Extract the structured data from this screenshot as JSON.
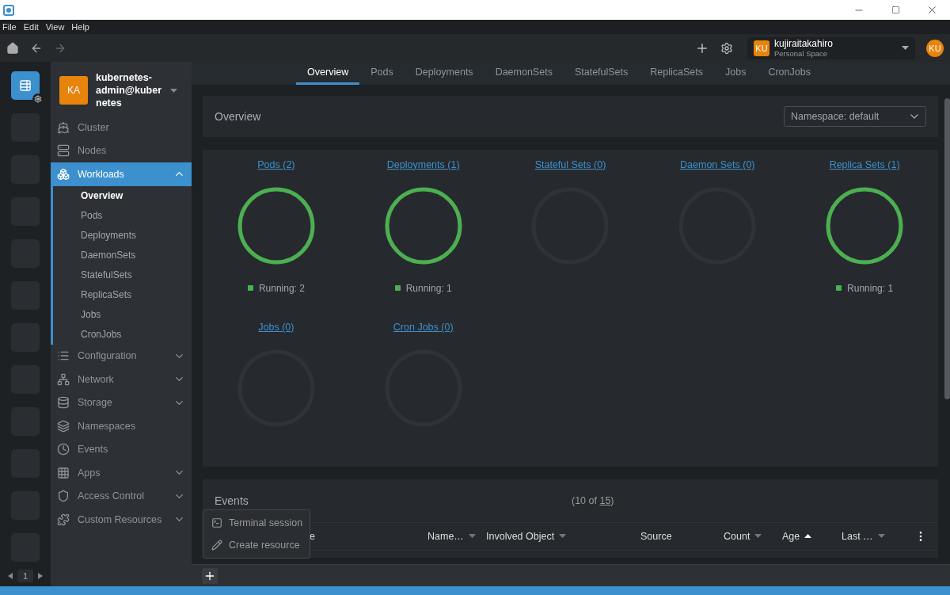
{
  "menu": [
    "File",
    "Edit",
    "View",
    "Help"
  ],
  "account": {
    "avatar": "KU",
    "name": "kujiraitakahiro",
    "subtitle": "Personal Space",
    "badge": "KU"
  },
  "hotbar": {
    "slots": [
      {
        "selected": true
      },
      {
        "selected": false
      },
      {
        "selected": false
      },
      {
        "selected": false
      },
      {
        "selected": false
      },
      {
        "selected": false
      },
      {
        "selected": false
      },
      {
        "selected": false
      },
      {
        "selected": false
      },
      {
        "selected": false
      },
      {
        "selected": false
      },
      {
        "selected": false
      }
    ],
    "page": "1"
  },
  "cluster": {
    "avatar": "KA",
    "name": "kubernetes-admin@kubernetes"
  },
  "sidebar": {
    "items": [
      {
        "label": "Cluster",
        "selected": false
      },
      {
        "label": "Nodes",
        "selected": false
      },
      {
        "label": "Workloads",
        "selected": true,
        "expanded": true,
        "children": [
          {
            "label": "Overview",
            "selected": true
          },
          {
            "label": "Pods",
            "selected": false
          },
          {
            "label": "Deployments",
            "selected": false
          },
          {
            "label": "DaemonSets",
            "selected": false
          },
          {
            "label": "StatefulSets",
            "selected": false
          },
          {
            "label": "ReplicaSets",
            "selected": false
          },
          {
            "label": "Jobs",
            "selected": false
          },
          {
            "label": "CronJobs",
            "selected": false
          }
        ]
      },
      {
        "label": "Configuration",
        "selected": false,
        "expanded": false
      },
      {
        "label": "Network",
        "selected": false,
        "expanded": false
      },
      {
        "label": "Storage",
        "selected": false,
        "expanded": false
      },
      {
        "label": "Namespaces",
        "selected": false
      },
      {
        "label": "Events",
        "selected": false
      },
      {
        "label": "Apps",
        "selected": false,
        "expanded": false
      },
      {
        "label": "Access Control",
        "selected": false,
        "expanded": false
      },
      {
        "label": "Custom Resources",
        "selected": false,
        "expanded": false
      }
    ]
  },
  "tabs": [
    {
      "label": "Overview",
      "selected": true
    },
    {
      "label": "Pods",
      "selected": false
    },
    {
      "label": "Deployments",
      "selected": false
    },
    {
      "label": "DaemonSets",
      "selected": false
    },
    {
      "label": "StatefulSets",
      "selected": false
    },
    {
      "label": "ReplicaSets",
      "selected": false
    },
    {
      "label": "Jobs",
      "selected": false
    },
    {
      "label": "CronJobs",
      "selected": false
    }
  ],
  "overview": {
    "title": "Overview",
    "namespace": "Namespace: default",
    "workloads": [
      {
        "title": "Pods (2)",
        "level": 1,
        "status": "Running: 2"
      },
      {
        "title": "Deployments (1)",
        "level": 1,
        "status": "Running: 1"
      },
      {
        "title": "Stateful Sets (0)",
        "level": 0
      },
      {
        "title": "Daemon Sets (0)",
        "level": 0
      },
      {
        "title": "Replica Sets (1)",
        "level": 1,
        "status": "Running: 1"
      },
      {
        "title": "Jobs (0)",
        "level": 0
      },
      {
        "title": "Cron Jobs (0)",
        "level": 0
      }
    ]
  },
  "events": {
    "title": "Events",
    "count_before": "(10 of",
    "count_link": "15",
    "count_after": ")",
    "columns": [
      {
        "label": "e"
      },
      {
        "label": "Name…",
        "sorted": false
      },
      {
        "label": "Involved Object",
        "sorted": false
      },
      {
        "label": "Source"
      },
      {
        "label": "Count",
        "sorted": false
      },
      {
        "label": "Age",
        "sorted": true
      },
      {
        "label": "Last …",
        "sorted": false
      }
    ]
  },
  "dock_menu": [
    "Terminal session",
    "Create resource"
  ]
}
